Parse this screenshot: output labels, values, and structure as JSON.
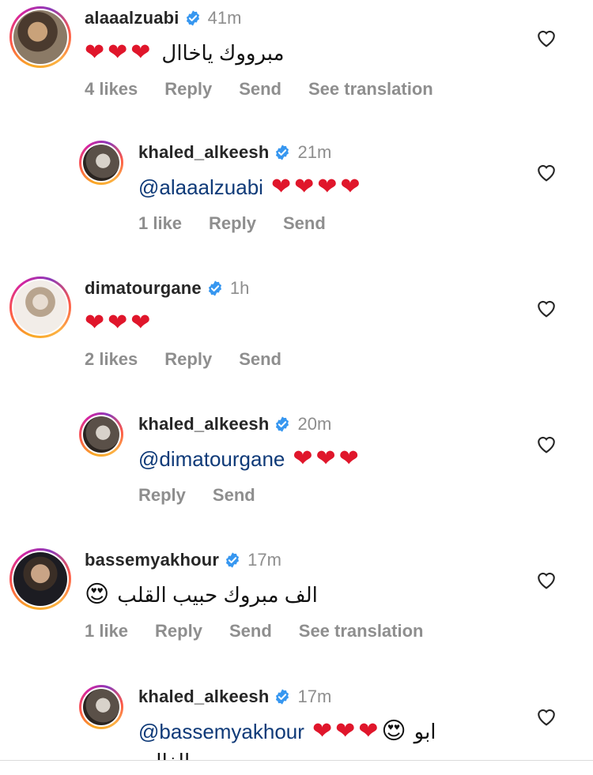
{
  "comments": [
    {
      "username": "alaaalzuabi",
      "time": "41m",
      "text": "مبرووك ياخاال",
      "hearts": 3,
      "likes": "4 likes",
      "reply": "Reply",
      "send": "Send",
      "see_translation": "See translation"
    },
    {
      "username": "khaled_alkeesh",
      "time": "21m",
      "mention": "@alaaalzuabi",
      "hearts": 4,
      "likes": "1 like",
      "reply": "Reply",
      "send": "Send"
    },
    {
      "username": "dimatourgane",
      "time": "1h",
      "hearts": 3,
      "likes": "2 likes",
      "reply": "Reply",
      "send": "Send"
    },
    {
      "username": "khaled_alkeesh",
      "time": "20m",
      "mention": "@dimatourgane",
      "hearts": 3,
      "reply": "Reply",
      "send": "Send"
    },
    {
      "username": "bassemyakhour",
      "time": "17m",
      "text": "الف مبروك حبيب القلب",
      "likes": "1 like",
      "reply": "Reply",
      "send": "Send",
      "see_translation": "See translation"
    },
    {
      "username": "khaled_alkeesh",
      "time": "17m",
      "mention": "@bassemyakhour",
      "text": "ابو",
      "text_line2": "روى الغالي"
    }
  ],
  "colors": {
    "verified": "#3797f0",
    "heart": "#e0162b",
    "mention": "#0f3a78",
    "muted": "#8e8e8e"
  }
}
